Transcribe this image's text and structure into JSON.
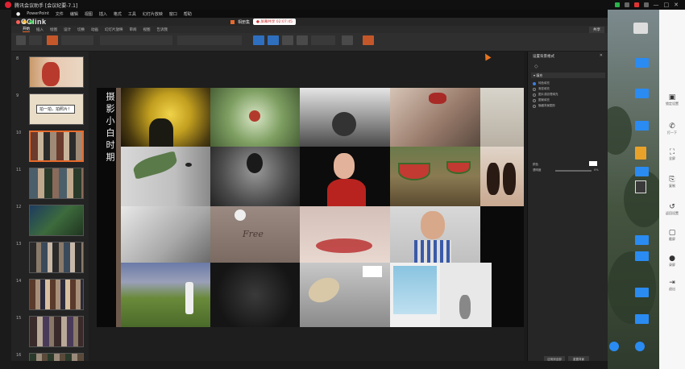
{
  "window": {
    "title": "腾讯会议助手 [会议纪要-7.1]",
    "tray": {
      "colors": [
        "#2ab34b",
        "#d33333"
      ]
    },
    "controls": [
      "—",
      "□",
      "✕"
    ]
  },
  "menubar": {
    "items": [
      "PowerPoint",
      "文件",
      "编辑",
      "视图",
      "插入",
      "格式",
      "工具",
      "幻灯片放映",
      "窗口",
      "帮助"
    ]
  },
  "document": {
    "name": "相册集",
    "recording": "● 屏幕共享 02:07:45"
  },
  "logo_text": "CClink",
  "ribbon": {
    "tabs": [
      "开始",
      "插入",
      "绘图",
      "设计",
      "切换",
      "动画",
      "幻灯片放映",
      "审阅",
      "视图",
      "告诉我"
    ],
    "active_tab": "开始",
    "share_label": "共享",
    "accent": "#e66a2c"
  },
  "thumbnails": {
    "numbers": [
      "8",
      "9",
      "10",
      "11",
      "12",
      "13",
      "14",
      "15",
      "16"
    ],
    "selected_index": 2,
    "slide9_text": "拍一拍，拍照片！"
  },
  "slide": {
    "vertical_title": "摄影小白时期",
    "free_text": "Free"
  },
  "panel": {
    "title": "设置背景格式",
    "close": "✕",
    "section": "▾ 填充",
    "options": [
      "纯色填充",
      "渐变填充",
      "图片或纹理填充",
      "图案填充",
      "隐藏背景图形"
    ],
    "selected_option": 0,
    "color_label": "颜色",
    "transparency_label": "透明度",
    "transparency_value": "0%",
    "buttons": [
      "应用到全部",
      "重置背景"
    ]
  },
  "desktop": {
    "folder_color": "#2a8bf2"
  },
  "dock": {
    "items": [
      {
        "icon": "▣",
        "label": "锁定设置"
      },
      {
        "icon": "✆",
        "label": "打一下"
      },
      {
        "icon": "⛶",
        "label": "全屏"
      },
      {
        "icon": "⎘",
        "label": "复制"
      },
      {
        "icon": "↺",
        "label": "返回设置"
      },
      {
        "icon": "▢",
        "label": "截屏"
      },
      {
        "icon": "●",
        "label": "录屏"
      },
      {
        "icon": "⇥",
        "label": "退出"
      }
    ]
  }
}
